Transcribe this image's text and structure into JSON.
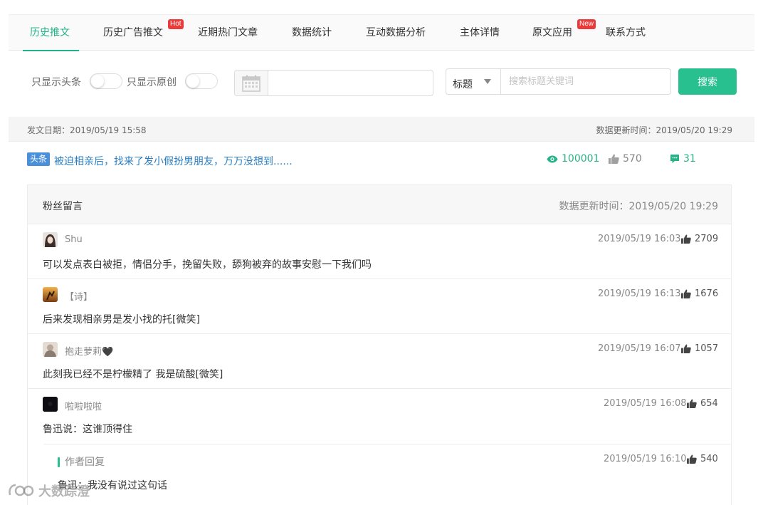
{
  "tabs": [
    {
      "label": "历史推文",
      "active": true
    },
    {
      "label": "历史广告推文",
      "badge": "Hot"
    },
    {
      "label": "近期热门文章"
    },
    {
      "label": "数据统计"
    },
    {
      "label": "互动数据分析"
    },
    {
      "label": "主体详情"
    },
    {
      "label": "原文应用",
      "badge": "New"
    },
    {
      "label": "联系方式"
    }
  ],
  "filters": {
    "toggle_headline_label": "只显示头条",
    "toggle_original_label": "只显示原创",
    "date_value": "",
    "select_value": "标题",
    "search_placeholder": "搜索标题关键词",
    "search_button": "搜索"
  },
  "info_bar": {
    "publish_date": "发文日期：2019/05/19 15:58",
    "updated": "数据更新时间：2019/05/20 19:29"
  },
  "article": {
    "tag": "头条",
    "title": "被迫相亲后，找来了发小假扮男朋友，万万没想到......",
    "views": "100001",
    "likes": "570",
    "comments": "31"
  },
  "comments_panel": {
    "title": "粉丝留言",
    "updated": "数据更新时间：2019/05/20 19:29",
    "comments": [
      {
        "name": "Shu",
        "time": "2019/05/19 16:03",
        "likes": "2709",
        "text": "可以发点表白被拒，情侣分手，挽留失败，舔狗被弃的故事安慰一下我们吗"
      },
      {
        "name": "【诗】",
        "time": "2019/05/19 16:13",
        "likes": "1676",
        "text": "后来发现相亲男是发小找的托[微笑]"
      },
      {
        "name": "抱走萝莉🖤",
        "time": "2019/05/19 16:07",
        "likes": "1057",
        "text": "此刻我已经不是柠檬精了 我是硫酸[微笑]"
      },
      {
        "name": "啦啦啦啦",
        "time": "2019/05/19 16:08",
        "likes": "654",
        "text": "鲁迅说：这谁顶得住"
      }
    ],
    "reply": {
      "label": "作者回复",
      "time": "2019/05/19 16:10",
      "likes": "540",
      "text": "鲁迅：我没有说过这句话"
    }
  },
  "watermark": "大数踪澄",
  "colors": {
    "accent": "#21b387",
    "link": "#2a7ec2",
    "tag": "#4a90d9",
    "badge": "#ea3a3a"
  }
}
